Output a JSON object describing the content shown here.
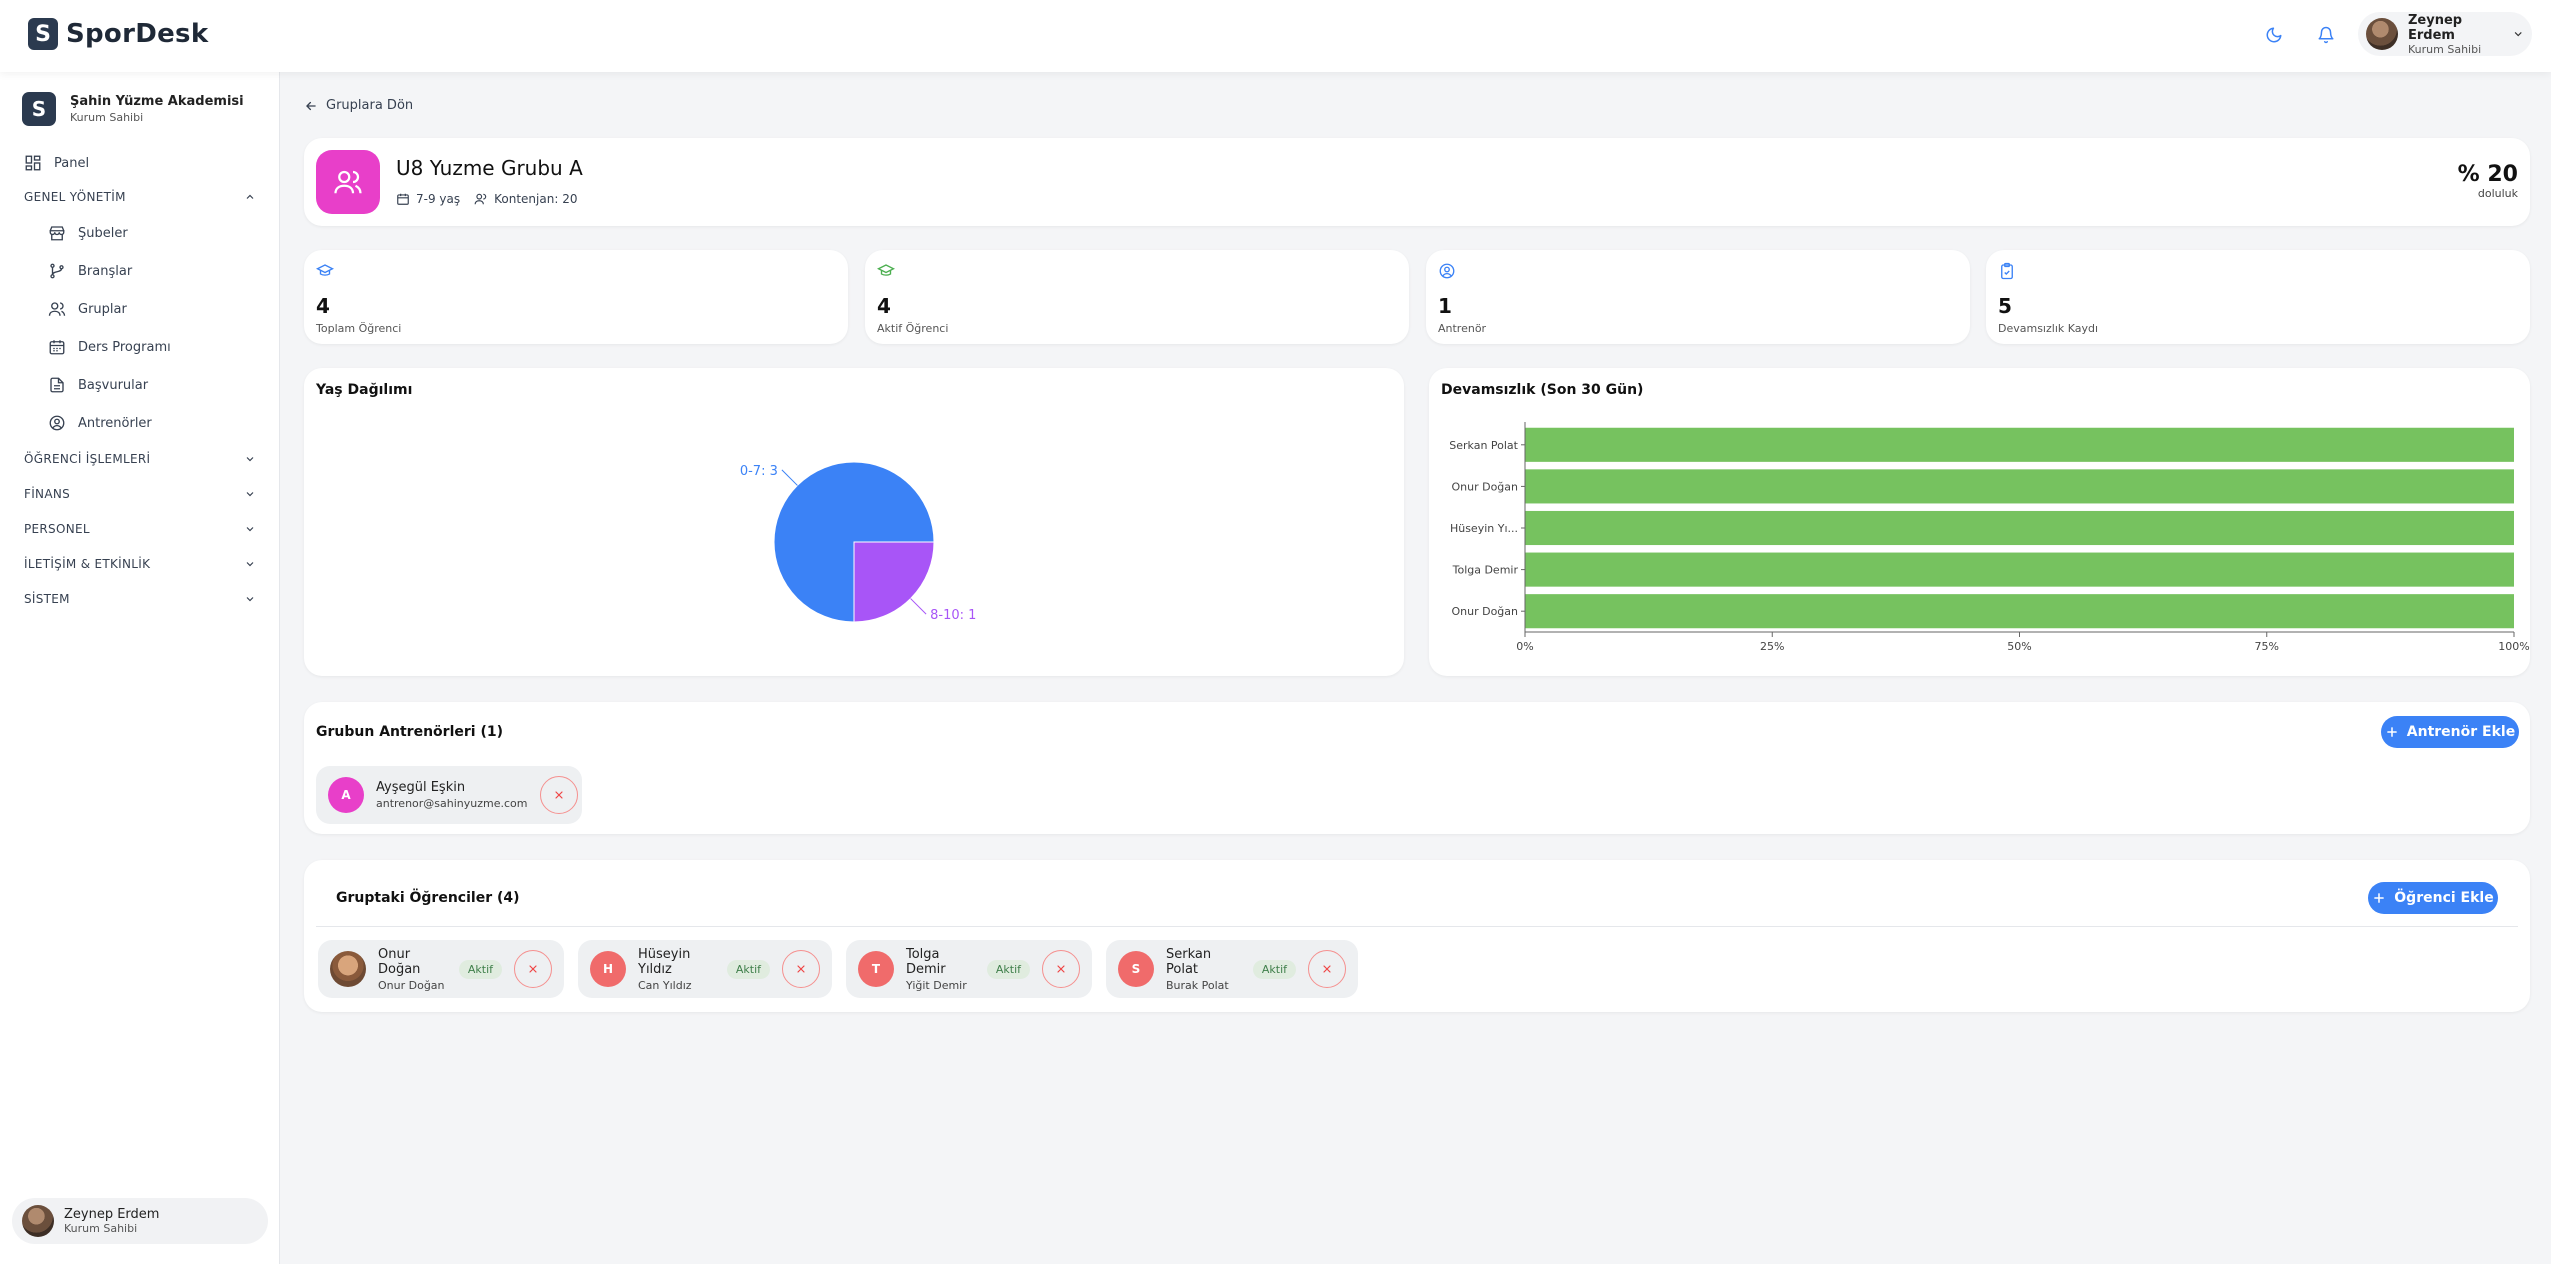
{
  "app": {
    "logo_letter": "S",
    "name": "SporDesk"
  },
  "topbar": {
    "user_name": "Zeynep Erdem",
    "user_role": "Kurum Sahibi",
    "accent": "#3b82f6"
  },
  "sidebar": {
    "org_letter": "S",
    "org_name": "Şahin Yüzme Akademisi",
    "org_role": "Kurum Sahibi",
    "panel_label": "Panel",
    "section_genel": "GENEL YÖNETİM",
    "genel_items": [
      {
        "label": "Şubeler",
        "icon": "store-icon"
      },
      {
        "label": "Branşlar",
        "icon": "branch-icon"
      },
      {
        "label": "Gruplar",
        "icon": "users-icon"
      },
      {
        "label": "Ders Programı",
        "icon": "calendar-icon"
      },
      {
        "label": "Başvurular",
        "icon": "file-icon"
      },
      {
        "label": "Antrenörler",
        "icon": "user-circle-icon"
      }
    ],
    "sections": [
      "ÖĞRENCİ İŞLEMLERİ",
      "FİNANS",
      "PERSONEL",
      "İLETİŞİM & ETKİNLİK",
      "SİSTEM"
    ],
    "bottom_user_name": "Zeynep Erdem",
    "bottom_user_role": "Kurum Sahibi"
  },
  "back_label": "Gruplara Dön",
  "group": {
    "title": "U8 Yuzme Grubu A",
    "age": "7-9 yaş",
    "capacity": "Kontenjan: 20",
    "fill_value": "% 20",
    "fill_label": "doluluk",
    "color": "#e83fc9"
  },
  "stats": [
    {
      "value": "4",
      "label": "Toplam Öğrenci",
      "icon": "graduation-cap-icon",
      "color": "#3b82f6"
    },
    {
      "value": "4",
      "label": "Aktif Öğrenci",
      "icon": "graduation-cap-icon",
      "color": "#4caf50"
    },
    {
      "value": "1",
      "label": "Antrenör",
      "icon": "user-circle-icon",
      "color": "#3b82f6"
    },
    {
      "value": "5",
      "label": "Devamsızlık Kaydı",
      "icon": "clipboard-check-icon",
      "color": "#3b82f6"
    }
  ],
  "age_chart_title": "Yaş Dağılımı",
  "attendance_chart_title": "Devamsızlık (Son 30 Gün)",
  "chart_data": [
    {
      "type": "pie",
      "title": "Yaş Dağılımı",
      "categories": [
        "0-7",
        "8-10"
      ],
      "values": [
        3,
        1
      ],
      "labels": [
        "0-7: 3",
        "8-10: 1"
      ],
      "colors": [
        "#3b82f6",
        "#a855f7"
      ]
    },
    {
      "type": "bar",
      "orientation": "horizontal",
      "title": "Devamsızlık (Son 30 Gün)",
      "categories": [
        "Serkan Polat",
        "Onur Doğan",
        "Hüseyin Yı...",
        "Tolga Demir",
        "Onur Doğan"
      ],
      "values": [
        100,
        100,
        100,
        100,
        100
      ],
      "xticks": [
        "0%",
        "25%",
        "50%",
        "75%",
        "100%"
      ],
      "xlim": [
        0,
        100
      ],
      "color": "#76c25f"
    }
  ],
  "coaches": {
    "title": "Grubun Antrenörleri (1)",
    "add_label": "Antrenör Ekle",
    "items": [
      {
        "initial": "A",
        "name": "Ayşegül Eşkin",
        "email": "antrenor@sahinyuzme.com",
        "color": "#e83fc9"
      }
    ]
  },
  "students": {
    "title": "Gruptaki Öğrenciler (4)",
    "add_label": "Öğrenci Ekle",
    "items": [
      {
        "initial": "",
        "name": "Onur Doğan",
        "parent": "Onur Doğan",
        "status": "Aktif",
        "color": "#c9a27a"
      },
      {
        "initial": "H",
        "name": "Hüseyin Yıldız",
        "parent": "Can Yıldız",
        "status": "Aktif",
        "color": "#f06b6b"
      },
      {
        "initial": "T",
        "name": "Tolga Demir",
        "parent": "Yiğit Demir",
        "status": "Aktif",
        "color": "#f06b6b"
      },
      {
        "initial": "S",
        "name": "Serkan Polat",
        "parent": "Burak Polat",
        "status": "Aktif",
        "color": "#f06b6b"
      }
    ]
  }
}
